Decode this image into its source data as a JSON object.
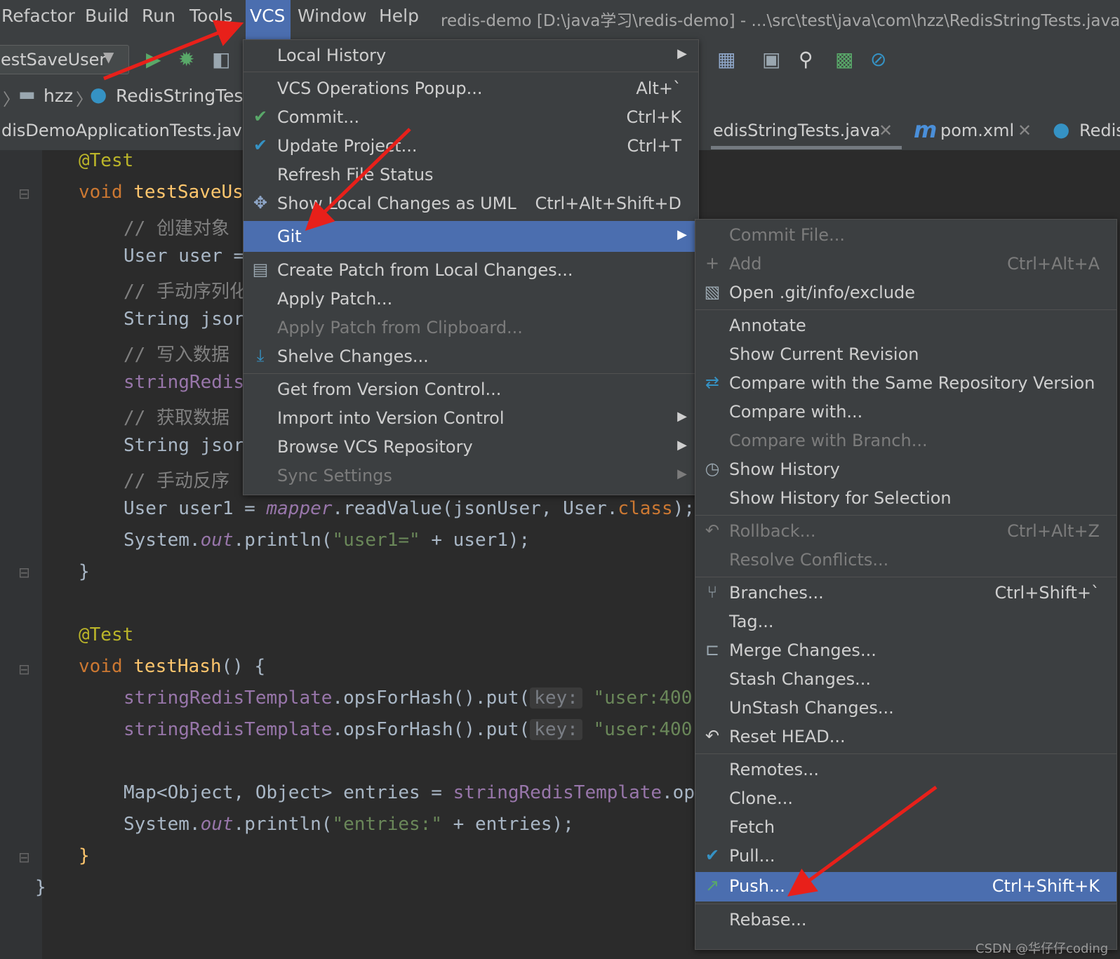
{
  "menubar": {
    "items": [
      "Refactor",
      "Build",
      "Run",
      "Tools",
      "VCS",
      "Window",
      "Help"
    ],
    "title": "redis-demo [D:\\java学习\\redis-demo] - ...\\src\\test\\java\\com\\hzz\\RedisStringTests.java"
  },
  "toolbar": {
    "run_config": "estSaveUser",
    "icons": [
      "run-icon",
      "debug-icon",
      "coverage-icon",
      "project-structure-icon",
      "terminal-icon",
      "search-icon",
      "profiler-icon",
      "stop-icon"
    ]
  },
  "navbar": {
    "folder": "hzz",
    "class": "RedisStringTests"
  },
  "tabs": [
    {
      "label": "disDemoApplicationTests.java"
    },
    {
      "label": "edisStringTests.java"
    },
    {
      "label": "pom.xml"
    },
    {
      "label": "Redis"
    }
  ],
  "code": {
    "l1_ann": "@Test",
    "l2_kw": "void ",
    "l2_fn": "testSaveUs",
    "l3_cm": "// 创建对象",
    "l4": "User user =",
    "l5_cm": "// 手动序列化",
    "l6": "String jsor",
    "l7_cm": "// 写入数据",
    "l8_fld": "stringRedis",
    "l9_cm": "// 获取数据",
    "l10": "String jsor",
    "l11_cm": "// 手动反序",
    "l12_a": "User user1 = ",
    "l12_b": "mapper",
    "l12_c": ".readValue(jsonUser, User.",
    "l12_d": "class",
    "l12_e": ");",
    "l13_a": "System.",
    "l13_b": "out",
    "l13_c": ".println(",
    "l13_d": "\"user1=\"",
    "l13_e": " + user1);",
    "l14": "}",
    "l15_ann": "@Test",
    "l16_kw": "void ",
    "l16_fn": "testHash",
    "l16_c": "() {",
    "l17_a": "stringRedisTemplate",
    "l17_b": ".opsForHash().put(",
    "l17_hint": "key:",
    "l17_str": "\"user:400\"",
    "l18_a": "stringRedisTemplate",
    "l18_b": ".opsForHash().put(",
    "l18_hint": "key:",
    "l18_str": "\"user:400\"",
    "l19_a": "Map<Object, Object> entries = ",
    "l19_b": "stringRedisTemplate",
    "l19_c": ".op",
    "l20_a": "System.",
    "l20_b": "out",
    "l20_c": ".println(",
    "l20_d": "\"entries:\"",
    "l20_e": " + entries);",
    "l21": "}",
    "l22": "}"
  },
  "vcs_menu": {
    "local_history": "Local History",
    "ops_popup": "VCS Operations Popup...",
    "ops_popup_sc": "Alt+`",
    "commit": "Commit...",
    "commit_sc": "Ctrl+K",
    "update": "Update Project...",
    "update_sc": "Ctrl+T",
    "refresh": "Refresh File Status",
    "uml": "Show Local Changes as UML",
    "uml_sc": "Ctrl+Alt+Shift+D",
    "git": "Git",
    "create_patch": "Create Patch from Local Changes...",
    "apply_patch": "Apply Patch...",
    "apply_clip": "Apply Patch from Clipboard...",
    "shelve": "Shelve Changes...",
    "get_vc": "Get from Version Control...",
    "import_vc": "Import into Version Control",
    "browse": "Browse VCS Repository",
    "sync": "Sync Settings"
  },
  "git_menu": {
    "commit_file": "Commit File...",
    "add": "Add",
    "add_sc": "Ctrl+Alt+A",
    "open_exclude": "Open .git/info/exclude",
    "annotate": "Annotate",
    "current_rev": "Show Current Revision",
    "compare_same": "Compare with the Same Repository Version",
    "compare_with": "Compare with...",
    "compare_branch": "Compare with Branch...",
    "history": "Show History",
    "history_sel": "Show History for Selection",
    "rollback": "Rollback...",
    "rollback_sc": "Ctrl+Alt+Z",
    "resolve": "Resolve Conflicts...",
    "branches": "Branches...",
    "branches_sc": "Ctrl+Shift+`",
    "tag": "Tag...",
    "merge": "Merge Changes...",
    "stash": "Stash Changes...",
    "unstash": "UnStash Changes...",
    "reset": "Reset HEAD...",
    "remotes": "Remotes...",
    "clone": "Clone...",
    "fetch": "Fetch",
    "pull": "Pull...",
    "push": "Push...",
    "push_sc": "Ctrl+Shift+K",
    "rebase": "Rebase..."
  },
  "watermark": "CSDN @华仔仔coding",
  "colors": {
    "selection": "#4b6eaf",
    "arrow": "#e8201a",
    "background": "#2b2b2b",
    "menu": "#3c3f41"
  }
}
